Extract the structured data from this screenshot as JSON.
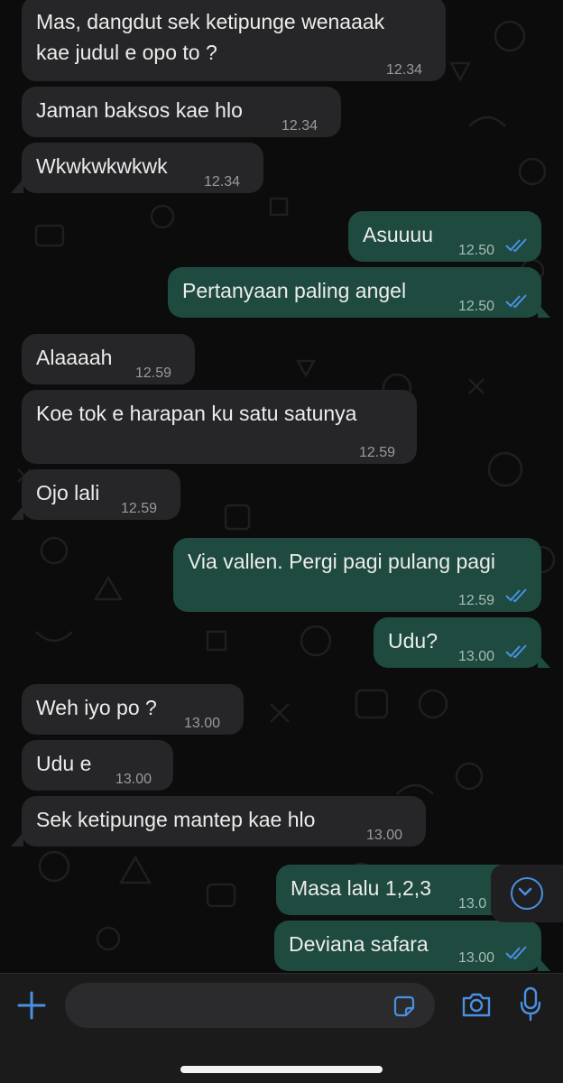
{
  "colors": {
    "incoming_bubble": "#262628",
    "outgoing_bubble": "#1e4a40",
    "read_ticks": "#4a90e2",
    "accent": "#4a90e2"
  },
  "messages": [
    {
      "direction": "in",
      "line1": "Mas, dangdut sek ketipunge wenaaak",
      "line2": "kae judul e opo to ?",
      "time": "12.34"
    },
    {
      "direction": "in",
      "text": "Jaman baksos kae hlo",
      "time": "12.34"
    },
    {
      "direction": "in",
      "text": "Wkwkwkwkwk",
      "time": "12.34"
    },
    {
      "direction": "out",
      "text": "Asuuuu",
      "time": "12.50",
      "status": "read"
    },
    {
      "direction": "out",
      "text": "Pertanyaan paling angel",
      "time": "12.50",
      "status": "read"
    },
    {
      "direction": "in",
      "text": "Alaaaah",
      "time": "12.59"
    },
    {
      "direction": "in",
      "text": "Koe tok e harapan ku satu satunya",
      "time": "12.59"
    },
    {
      "direction": "in",
      "text": "Ojo lali",
      "time": "12.59"
    },
    {
      "direction": "out",
      "text": "Via vallen. Pergi pagi pulang pagi",
      "time": "12.59",
      "status": "read"
    },
    {
      "direction": "out",
      "text": "Udu?",
      "time": "13.00",
      "status": "read"
    },
    {
      "direction": "in",
      "text": "Weh iyo po ?",
      "time": "13.00"
    },
    {
      "direction": "in",
      "text": "Udu e",
      "time": "13.00"
    },
    {
      "direction": "in",
      "text": "Sek ketipunge mantep kae hlo",
      "time": "13.00"
    },
    {
      "direction": "out",
      "text": "Masa lalu 1,2,3",
      "time": "13.0",
      "status": "read"
    },
    {
      "direction": "out",
      "text": "Deviana safara",
      "time": "13.00",
      "status": "read"
    }
  ],
  "composer": {
    "placeholder": "",
    "icons": [
      "plus-icon",
      "sticker-icon",
      "camera-icon",
      "microphone-icon"
    ]
  },
  "scroll_button": {
    "icon": "chevron-down-icon"
  }
}
